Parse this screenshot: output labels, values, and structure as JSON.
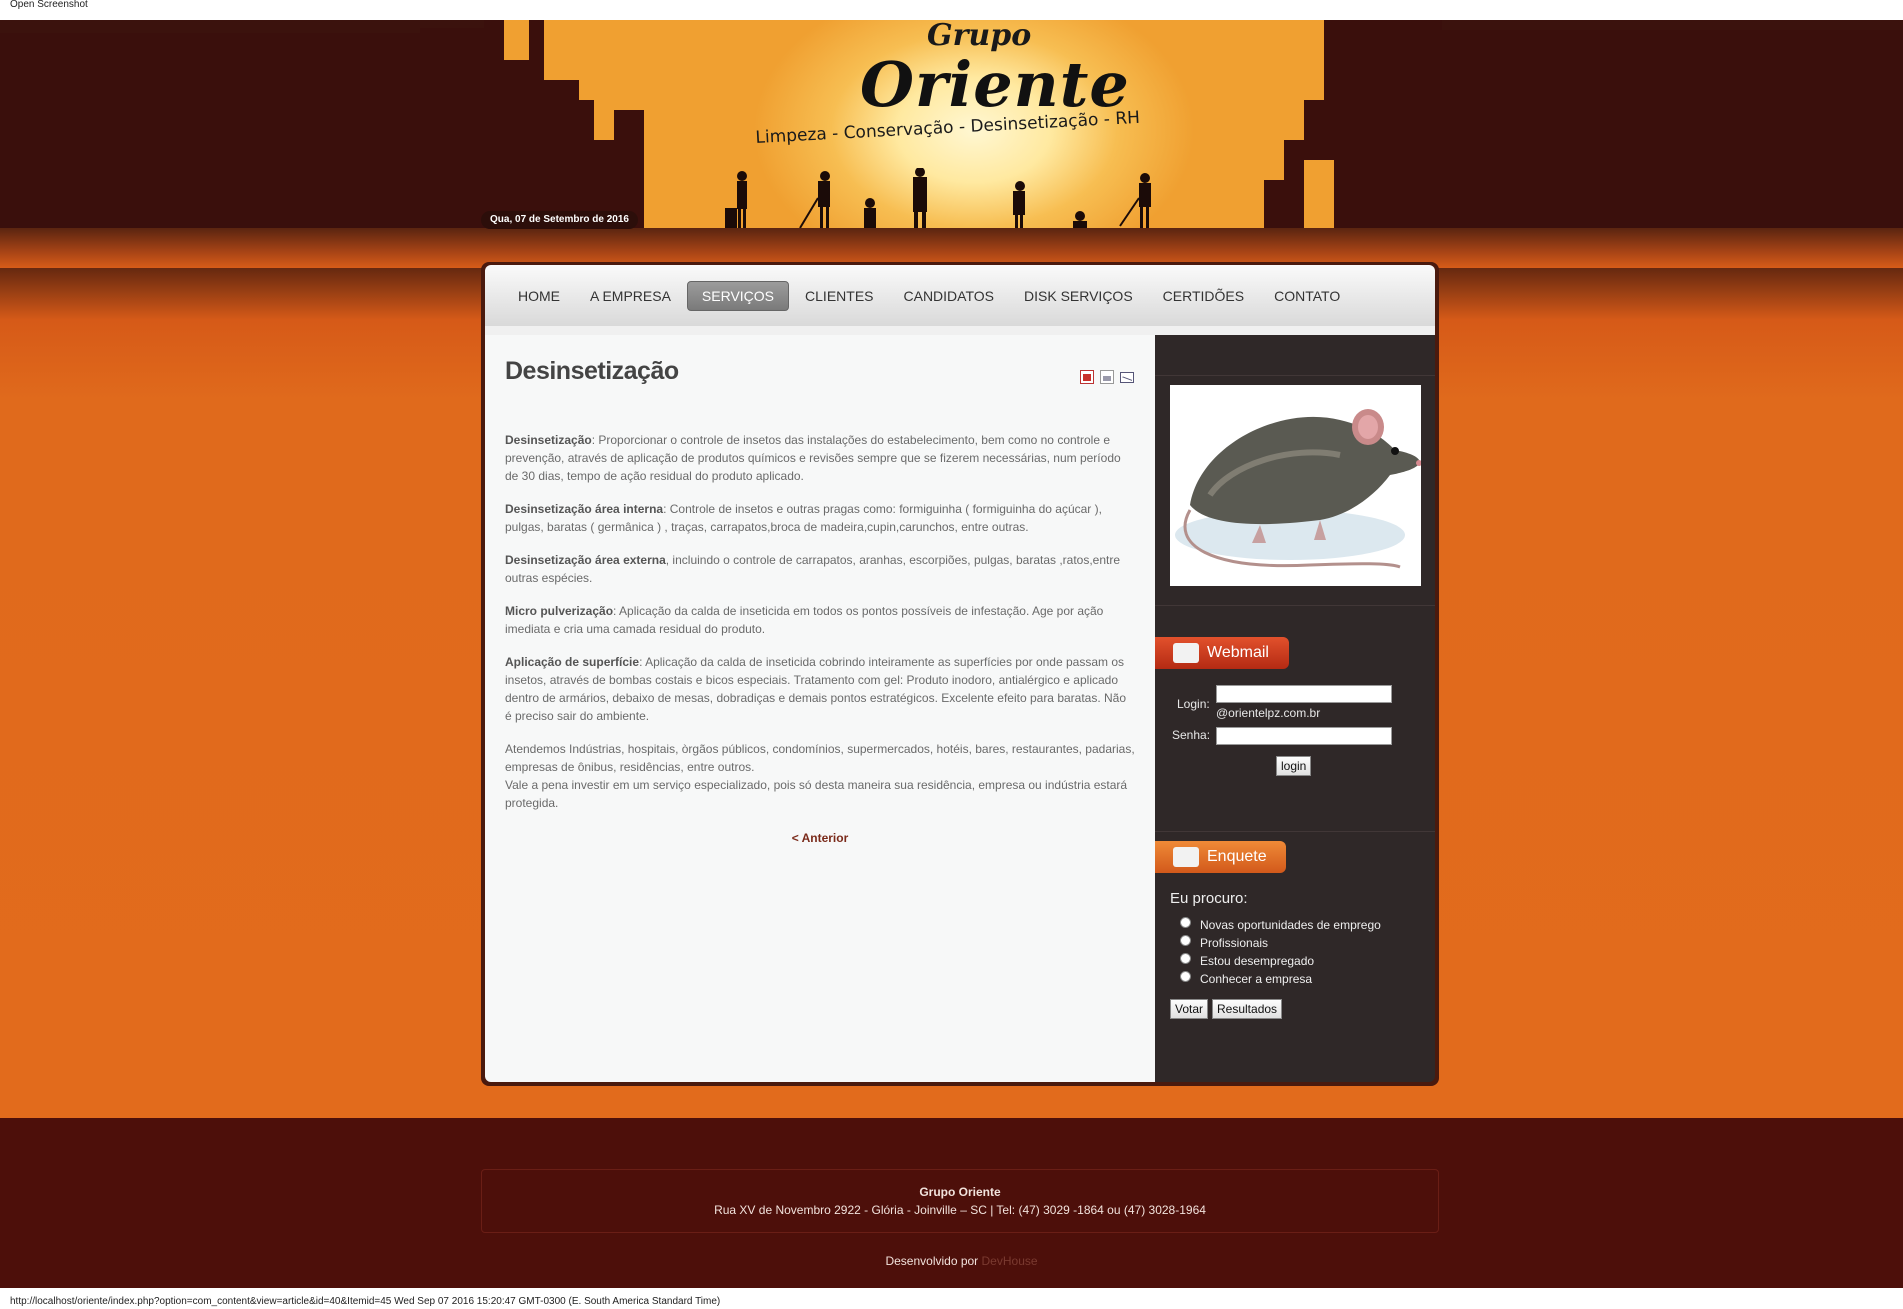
{
  "window": {
    "title": "Open Screenshot",
    "status_url": "http://localhost/oriente/index.php?option=com_content&view=article&id=40&Itemid=45 Wed Sep 07 2016 15:20:47 GMT-0300 (E. South America Standard Time)"
  },
  "header": {
    "logo_line1": "Grupo",
    "logo_line2": "Oriente",
    "tagline": "Limpeza - Conservação - Desinsetização - RH",
    "date": "Qua, 07 de Setembro de 2016"
  },
  "nav": {
    "items": [
      {
        "label": "HOME"
      },
      {
        "label": "A EMPRESA"
      },
      {
        "label": "SERVIÇOS",
        "active": true
      },
      {
        "label": "CLIENTES"
      },
      {
        "label": "CANDIDATOS"
      },
      {
        "label": "DISK SERVIÇOS"
      },
      {
        "label": "CERTIDÕES"
      },
      {
        "label": "CONTATO"
      }
    ]
  },
  "article": {
    "title": "Desinsetização",
    "paragraphs": [
      {
        "bold": "Desinsetização",
        "text": ": Proporcionar o controle de insetos das instalações do estabelecimento, bem como no controle e prevenção, através de aplicação de produtos químicos e revisões sempre que se fizerem necessárias, num período de 30 dias, tempo de ação residual do produto aplicado."
      },
      {
        "bold": "Desinsetização área interna",
        "text": ": Controle de insetos e outras pragas como: formiguinha ( formiguinha do açúcar ), pulgas, baratas ( germânica ) , traças, carrapatos,broca de madeira,cupin,carunchos, entre outras."
      },
      {
        "bold": "Desinsetização área externa",
        "text": ", incluindo o controle de carrapatos, aranhas, escorpiões, pulgas, baratas ,ratos,entre outras espécies."
      },
      {
        "bold": "Micro pulverização",
        "text": ": Aplicação da calda de inseticida em todos os pontos possíveis de infestação. Age por ação imediata e cria uma camada residual do produto."
      },
      {
        "bold": "Aplicação de superfície",
        "text": ": Aplicação da calda de inseticida cobrindo inteiramente as superfícies por onde passam os insetos, através de bombas costais e bicos especiais. Tratamento com gel: Produto inodoro, antialérgico e aplicado dentro de armários, debaixo de mesas, dobradiças e demais pontos estratégicos. Excelente efeito para baratas. Não é preciso sair do ambiente."
      }
    ],
    "closing_1": "Atendemos Indústrias, hospitais, òrgãos públicos, condomínios, supermercados, hotéis, bares, restaurantes, padarias, empresas de ônibus, residências, entre outros.",
    "closing_2": "Vale a pena investir em um serviço especializado, pois só desta maneira sua residência, empresa ou indústria estará protegida.",
    "pager": "< Anterior",
    "tools": [
      "pdf-icon",
      "print-icon",
      "email-icon"
    ]
  },
  "webmail": {
    "title": "Webmail",
    "login_label": "Login:",
    "domain": "@orientelpz.com.br",
    "password_label": "Senha:",
    "login_value": "",
    "password_value": "",
    "button": "login"
  },
  "poll": {
    "title": "Enquete",
    "question": "Eu procuro:",
    "options": [
      "Novas oportunidades de emprego",
      "Profissionais",
      "Estou desempregado",
      "Conhecer a empresa"
    ],
    "vote_button": "Votar",
    "results_button": "Resultados"
  },
  "footer": {
    "company": "Grupo Oriente",
    "address": "Rua XV de Novembro 2922 - Glória - Joinville – SC | Tel: (47) 3029 -1864 ou (47) 3028-1964",
    "dev_prefix": "Desenvolvido por",
    "dev_link": "DevHouse"
  },
  "colors": {
    "accent": "#e06a1c",
    "dark_brown": "#3b120d",
    "footer_bg": "#4d0f0a",
    "sidebar_bg": "#2f2828",
    "webmail_red": "#c83a1e",
    "enquete_orange": "#e2742a"
  }
}
